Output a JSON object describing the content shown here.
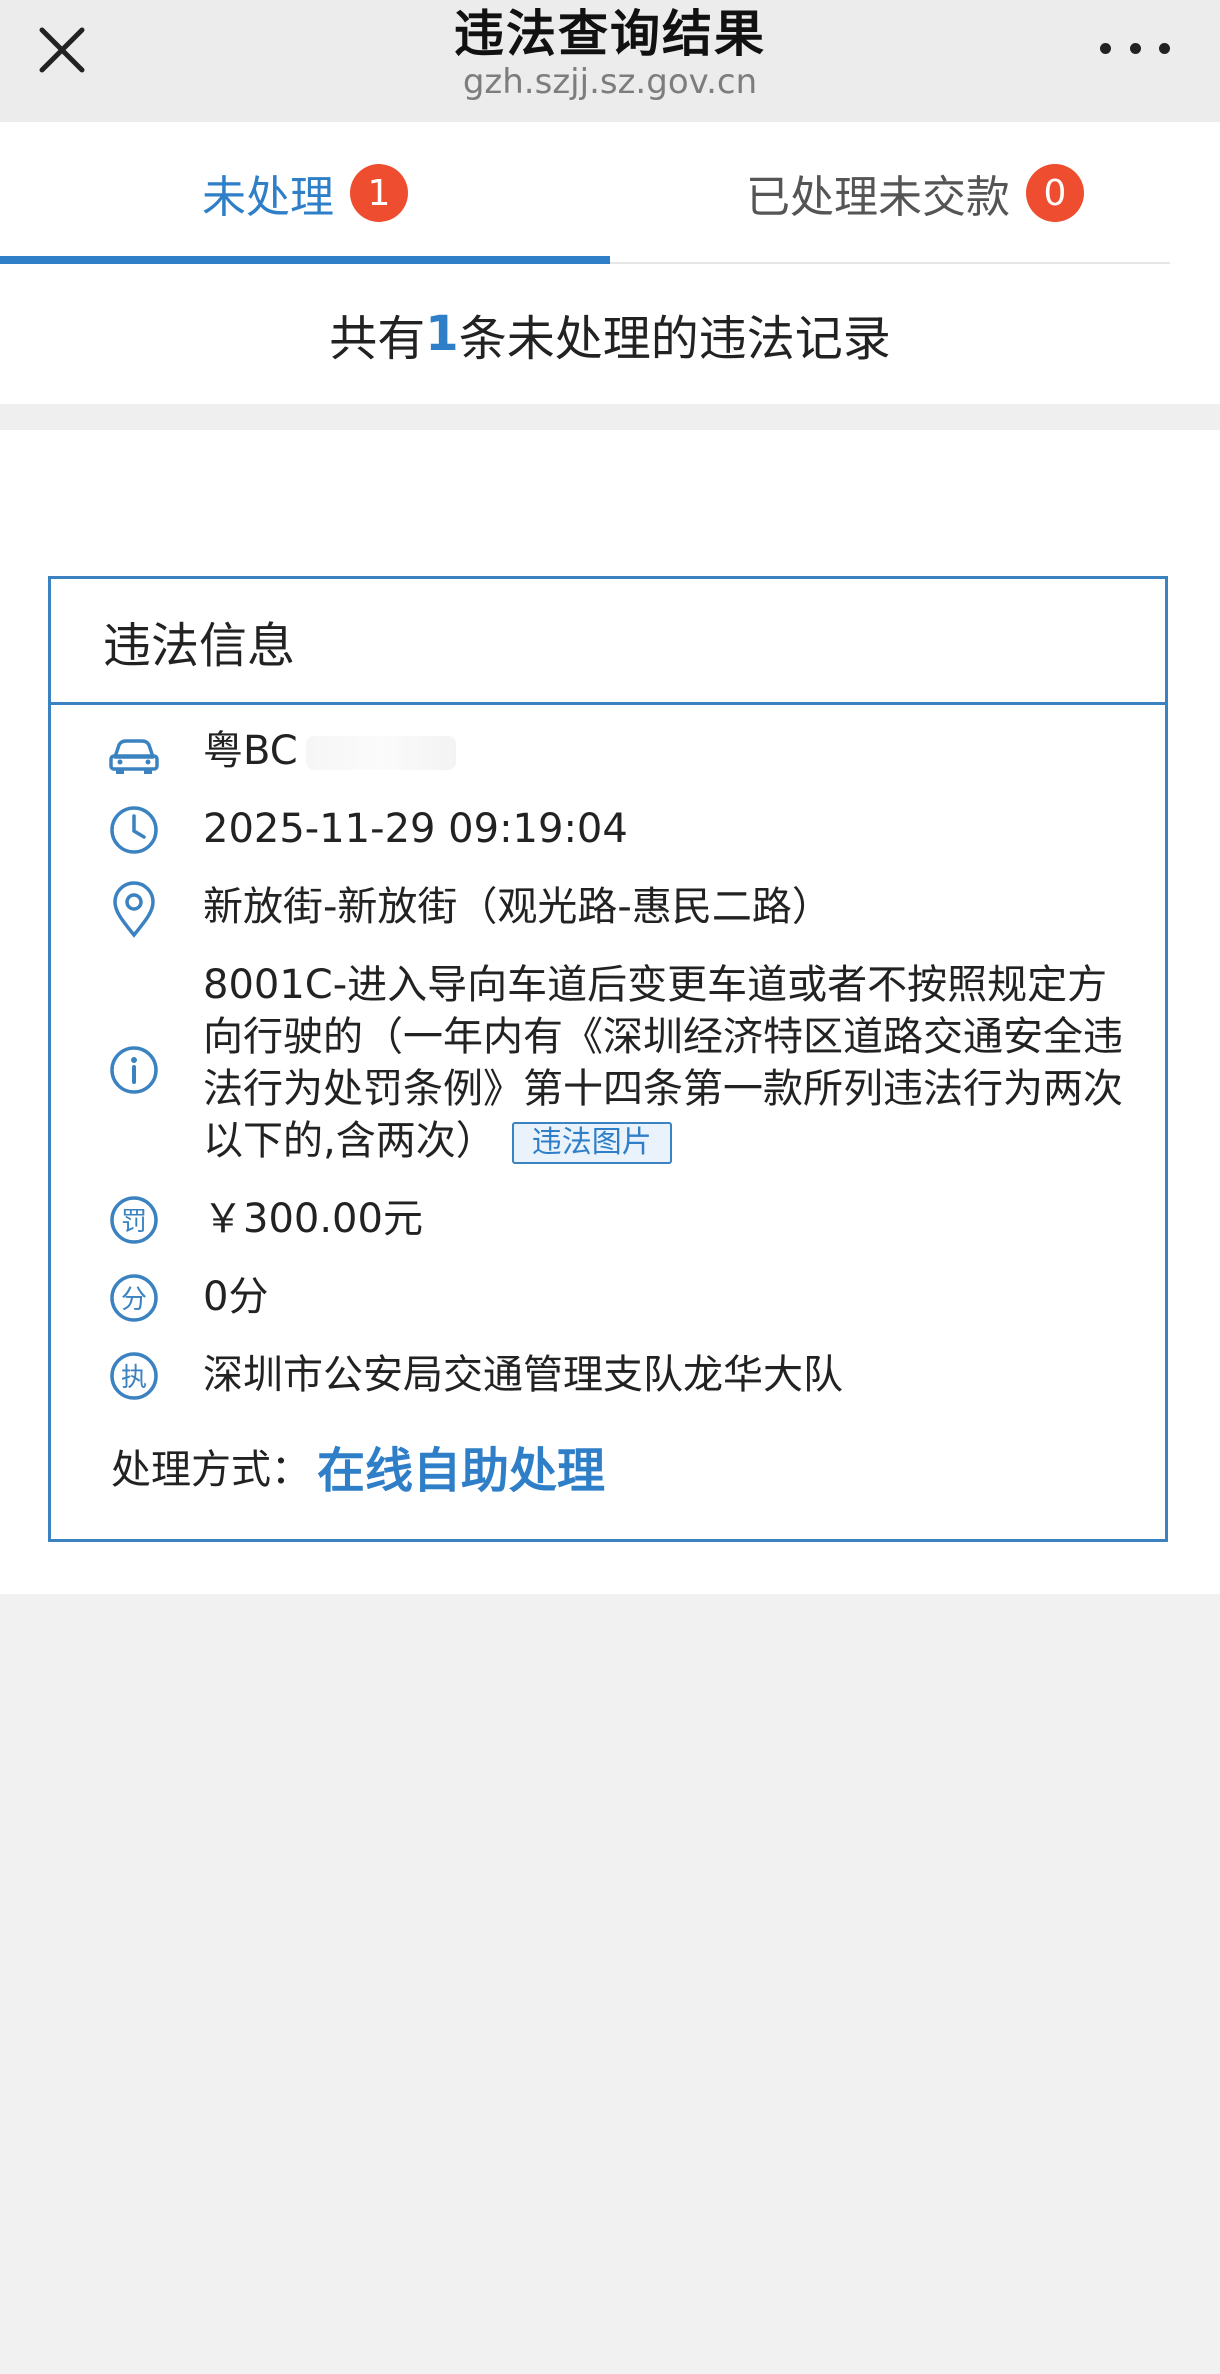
{
  "header": {
    "title": "违法查询结果",
    "url": "gzh.szjj.sz.gov.cn"
  },
  "tabs": [
    {
      "label": "未处理",
      "count": "1"
    },
    {
      "label": "已处理未交款",
      "count": "0"
    }
  ],
  "summary": {
    "prefix": "共有",
    "count": "1",
    "suffix": "条未处理的违法记录"
  },
  "card": {
    "title": "违法信息",
    "plate": "粤BC",
    "time": "2025-11-29 09:19:04",
    "location": "新放街-新放街（观光路-惠民二路）",
    "violation": "8001C-进入导向车道后变更车道或者不按照规定方向行驶的（一年内有《深圳经济特区道路交通安全违法行为处罚条例》第十四条第一款所列违法行为两次以下的,含两次）",
    "photo_button": "违法图片",
    "fine": "￥300.00元",
    "points": "0分",
    "authority": "深圳市公安局交通管理支队龙华大队",
    "handle_label": "处理方式：",
    "handle_link": "在线自助处理"
  },
  "colors": {
    "accent": "#2f7fc8",
    "badge": "#ef4d2f"
  }
}
